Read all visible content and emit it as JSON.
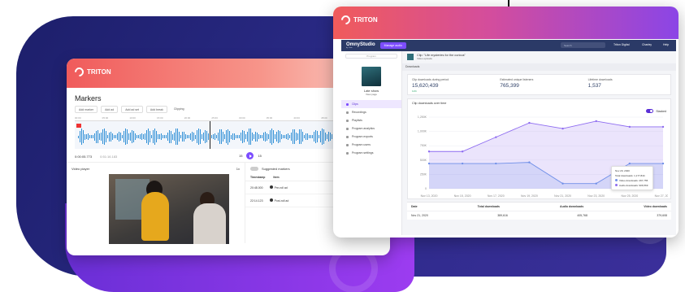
{
  "brand": "TRITON",
  "left": {
    "title": "Markers",
    "tools": [
      "Add marker",
      "Add ad",
      "Add ad set",
      "Add break",
      "Clipping"
    ],
    "timeline": [
      "00:00",
      "05:00",
      "10:00",
      "15:00",
      "20:00",
      "25:00",
      "30:00",
      "35:00",
      "40:00",
      "45:00",
      "50:00",
      "55:00"
    ],
    "time_current": "0:00:05.773",
    "time_total": "0:51:16.183",
    "skip_back": "15",
    "skip_fwd": "15",
    "video_label": "Video player",
    "video_speed": "1x",
    "suggested_label": "Suggested markers",
    "col_timestamp": "Timestamp",
    "col_item": "Item",
    "rows": [
      {
        "time": "20:48.000",
        "item": "Pre-roll ad"
      },
      {
        "time": "22:14.123",
        "item": "Post-roll ad"
      }
    ]
  },
  "right": {
    "app_name": "OmnyStudio",
    "app_sub": "by Triton",
    "manage_btn": "Manage audio",
    "search": "Search",
    "org": "Triton Digital",
    "user": "Charley",
    "help": "Help",
    "sidebar_search": "Program",
    "podcast_title": "Late show",
    "podcast_link": "View page",
    "sidebar_items": [
      "Clips",
      "Recordings",
      "Playlists",
      "Program analytics",
      "Program exports",
      "Program users",
      "Program settings"
    ],
    "clip_title": "Clip: \"Life mysteries for the curious\"",
    "clip_sub": "Video episode",
    "tab": "Downloads",
    "stats": [
      {
        "label": "Clip downloads during period",
        "value": "15,620,439",
        "change": "11%"
      },
      {
        "label": "Estimated unique listeners",
        "value": "765,399",
        "change": ""
      },
      {
        "label": "Lifetime downloads",
        "value": "1,537",
        "change": ""
      }
    ],
    "chart_title": "Clip downloads over time",
    "stacked_label": "Stacked",
    "tooltip": {
      "date": "Nov 20, 2020",
      "total": "Total downloads: 1,177,844",
      "video": "Video downloads: 267,755",
      "audio": "Audio downloads: 906,569"
    },
    "table_cols": [
      "Date",
      "Total downloads",
      "Audio downloads",
      "Video downloads"
    ],
    "table_row": [
      "Nov 21, 2020",
      "389,616",
      "405,768",
      "379,608"
    ]
  },
  "chart_data": {
    "type": "area",
    "categories": [
      "Nov 13, 2020",
      "Nov 15, 2020",
      "Nov 17, 2020",
      "Nov 19, 2020",
      "Nov 21, 2020",
      "Nov 23, 2020",
      "Nov 25, 2020",
      "Nov 27, 2020"
    ],
    "y_ticks": [
      "0",
      "250K",
      "500K",
      "750K",
      "1,000K",
      "1,250K"
    ],
    "ylim": [
      0,
      1250000
    ],
    "series": [
      {
        "name": "Video downloads",
        "color": "#6f8fe8",
        "values": [
          440000,
          440000,
          440000,
          460000,
          90000,
          90000,
          440000,
          440000
        ]
      },
      {
        "name": "Audio downloads",
        "color": "#8e6cf0",
        "values": [
          650000,
          650000,
          900000,
          1150000,
          1050000,
          1180000,
          1080000,
          1080000
        ]
      }
    ],
    "title": "Clip downloads over time"
  },
  "colors": {
    "accent": "#7c4dff",
    "navy": "#2b3a67",
    "positive": "#2aa66a"
  }
}
